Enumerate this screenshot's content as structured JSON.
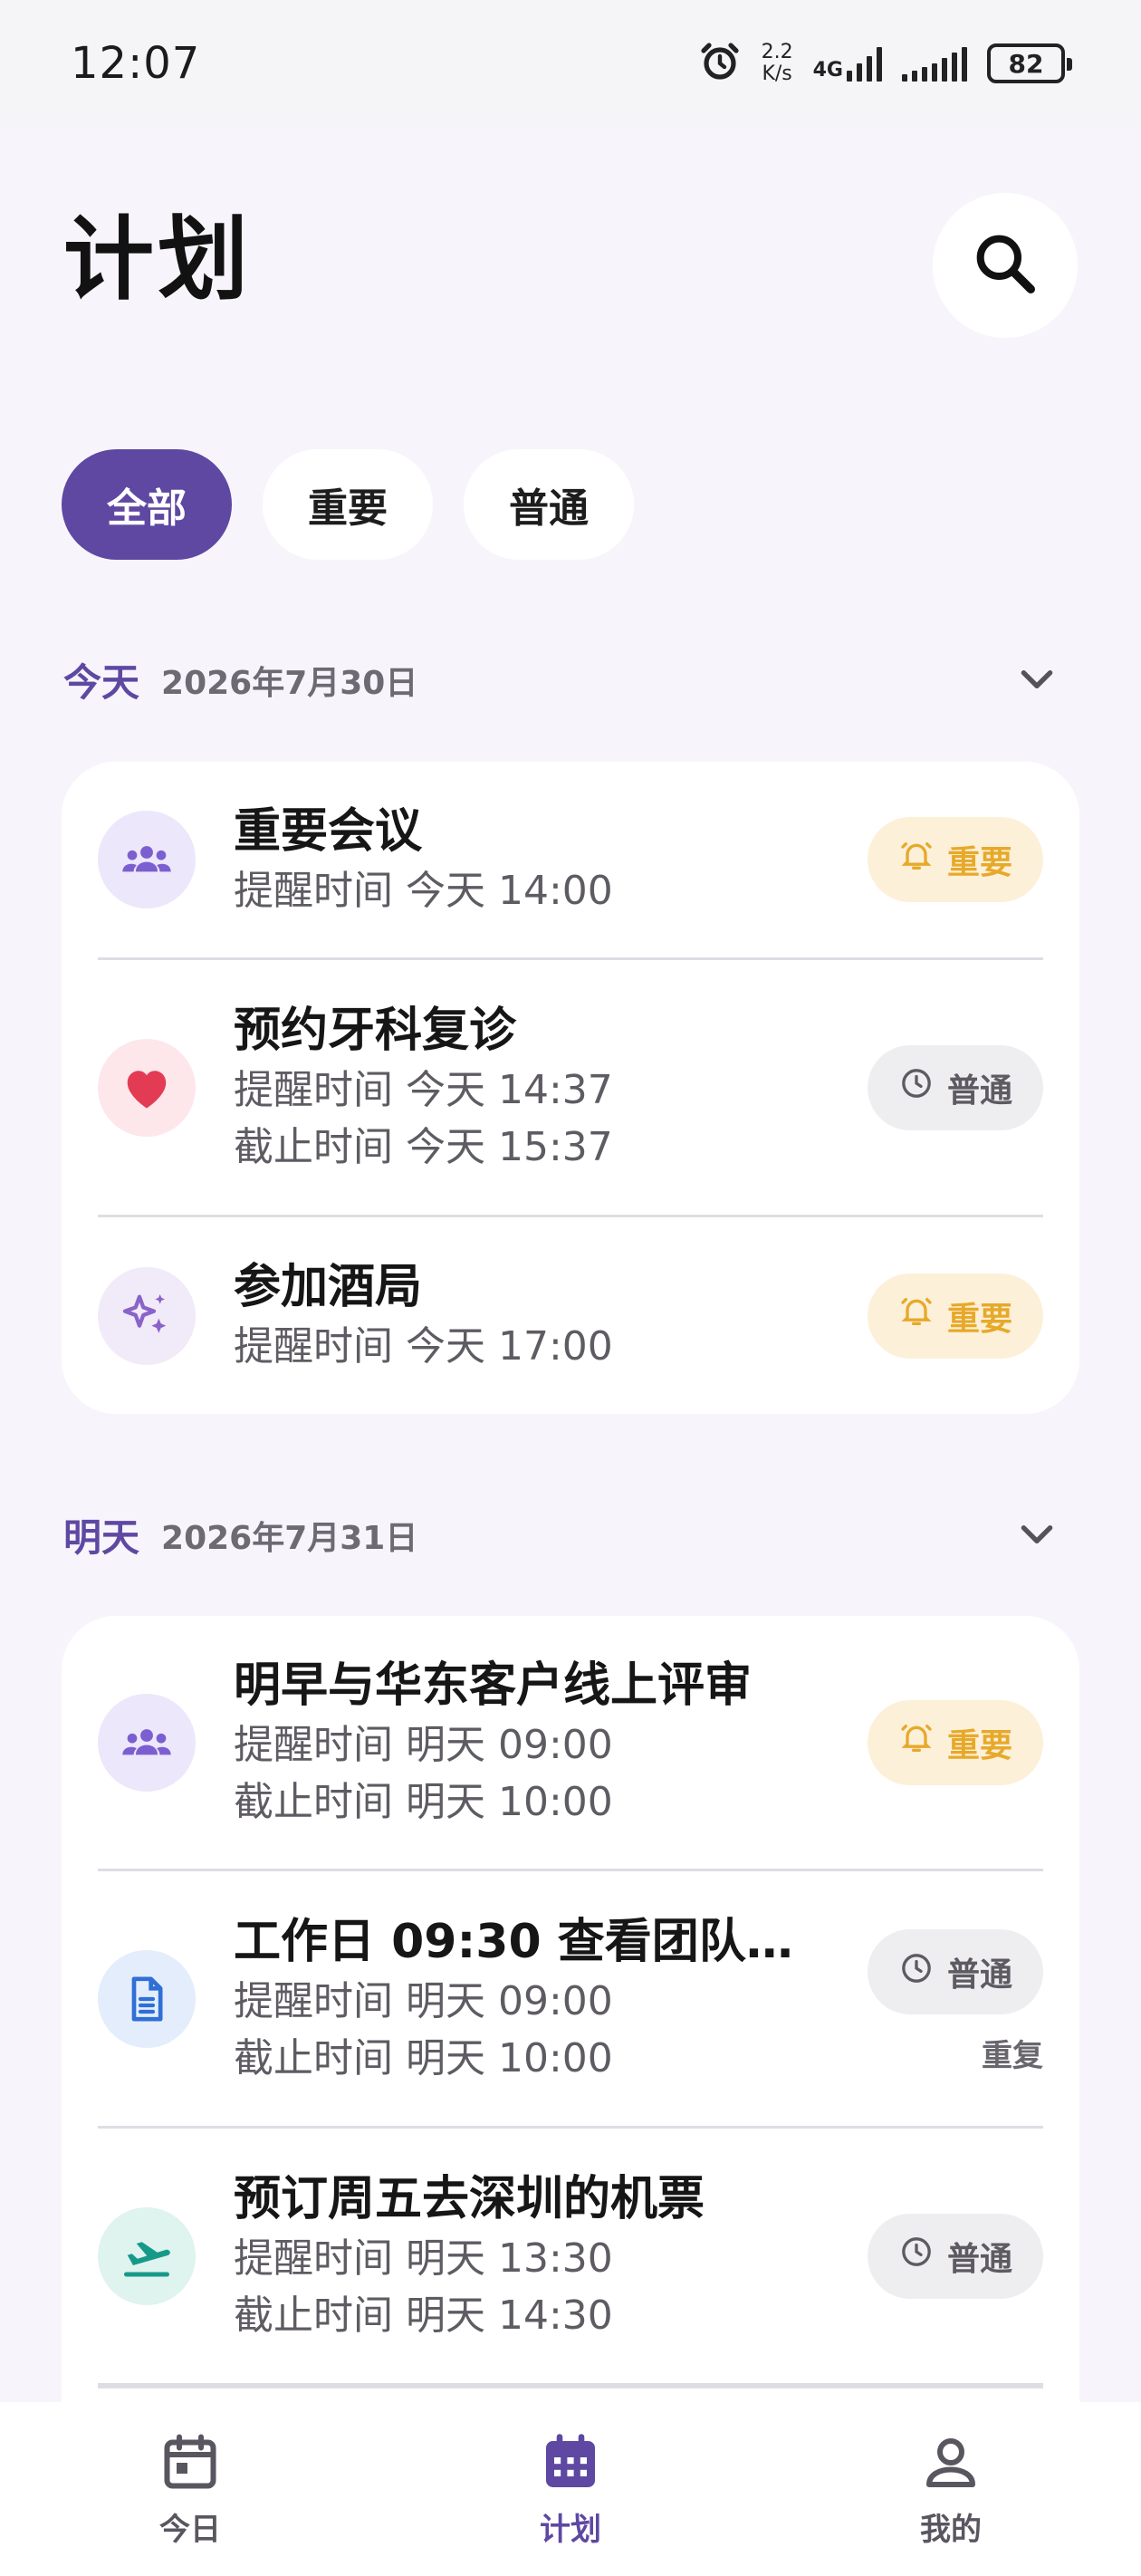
{
  "status_bar": {
    "time": "12:07",
    "speed_top": "2.2",
    "speed_bottom": "K/s",
    "network": "4G",
    "battery": "82",
    "alarm_icon": "alarm-icon"
  },
  "header": {
    "title": "计划",
    "search_icon": "search-icon"
  },
  "filters": [
    {
      "label": "全部",
      "active": true
    },
    {
      "label": "重要",
      "active": false
    },
    {
      "label": "普通",
      "active": false
    }
  ],
  "sections": [
    {
      "label": "今天",
      "date": "2026年7月30日",
      "items": [
        {
          "title": "重要会议",
          "lines": [
            "提醒时间 今天 14:00"
          ],
          "badge": "重要",
          "badge_type": "important",
          "icon": "group-icon",
          "icon_bg": "#ede7fb",
          "icon_color": "#7b5fd0"
        },
        {
          "title": "预约牙科复诊",
          "lines": [
            "提醒时间 今天 14:37",
            "截止时间 今天 15:37"
          ],
          "badge": "普通",
          "badge_type": "normal",
          "icon": "heart-icon",
          "icon_bg": "#fde7ea",
          "icon_color": "#e43b54"
        },
        {
          "title": "参加酒局",
          "lines": [
            "提醒时间 今天 17:00"
          ],
          "badge": "重要",
          "badge_type": "important",
          "icon": "sparkle-icon",
          "icon_bg": "#f1eaf8",
          "icon_color": "#8a63c9"
        }
      ]
    },
    {
      "label": "明天",
      "date": "2026年7月31日",
      "items": [
        {
          "title": "明早与华东客户线上评审",
          "lines": [
            "提醒时间 明天 09:00",
            "截止时间 明天 10:00"
          ],
          "badge": "重要",
          "badge_type": "important",
          "icon": "group-icon",
          "icon_bg": "#ede7fb",
          "icon_color": "#7b5fd0"
        },
        {
          "title": "工作日 09:30 查看团队...",
          "lines": [
            "提醒时间 明天 09:00",
            "截止时间 明天 10:00"
          ],
          "badge": "普通",
          "badge_type": "normal",
          "extra": "重复",
          "icon": "document-icon",
          "icon_bg": "#e3edfb",
          "icon_color": "#2f6fd6"
        },
        {
          "title": "预订周五去深圳的机票",
          "lines": [
            "提醒时间 明天 13:30",
            "截止时间 明天 14:30"
          ],
          "badge": "普通",
          "badge_type": "normal",
          "icon": "flight-icon",
          "icon_bg": "#dff3ef",
          "icon_color": "#17998a"
        }
      ]
    }
  ],
  "bottom_nav": [
    {
      "label": "今日",
      "icon": "calendar-today-icon",
      "active": false
    },
    {
      "label": "计划",
      "icon": "calendar-month-icon",
      "active": true
    },
    {
      "label": "我的",
      "icon": "person-icon",
      "active": false
    }
  ],
  "colors": {
    "accent": "#5e48a2",
    "important_bg": "#fdf0d9",
    "important_fg": "#e7a92a",
    "normal_bg": "#eeedf0",
    "normal_fg": "#5e5a62"
  }
}
